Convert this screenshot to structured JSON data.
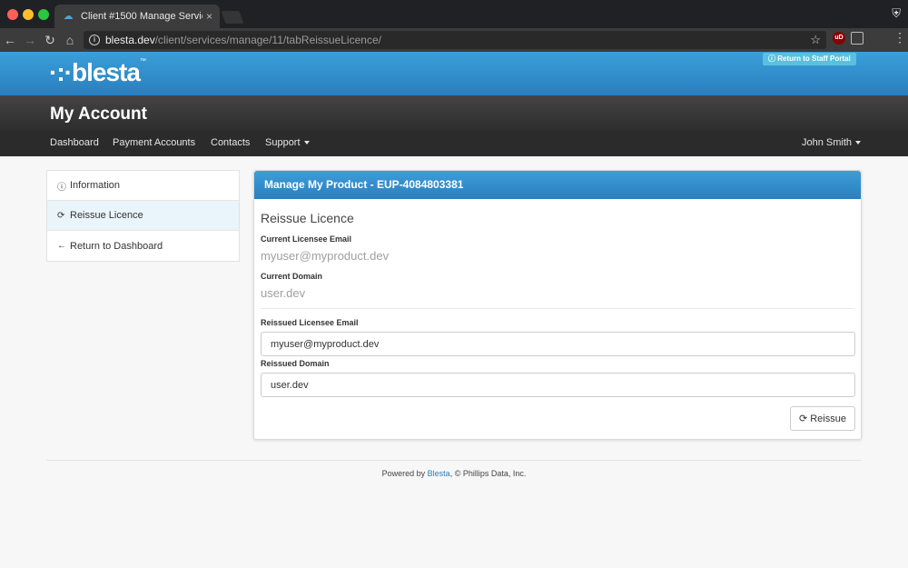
{
  "browser": {
    "tab_title": "Client #1500 Manage Service",
    "url_host": "blesta.dev",
    "url_path": "/client/services/manage/11/tabReissueLicence/",
    "extension_label": "uD"
  },
  "header": {
    "logo_text": "blesta",
    "logo_mark": "™",
    "staff_portal_label": "Return to Staff Portal",
    "page_title": "My Account"
  },
  "nav": {
    "items": [
      {
        "label": "Dashboard"
      },
      {
        "label": "Payment Accounts"
      },
      {
        "label": "Contacts"
      },
      {
        "label": "Support"
      }
    ],
    "user": "John Smith"
  },
  "sidebar": {
    "items": [
      {
        "label": "Information",
        "icon": "info-circle-icon"
      },
      {
        "label": "Reissue Licence",
        "icon": "refresh-icon"
      },
      {
        "label": "Return to Dashboard",
        "icon": "arrow-left-icon"
      }
    ]
  },
  "panel": {
    "heading": "Manage My Product - EUP-4084803381",
    "section_title": "Reissue Licence",
    "current_email_label": "Current Licensee Email",
    "current_email": "myuser@myproduct.dev",
    "current_domain_label": "Current Domain",
    "current_domain": "user.dev",
    "reissued_email_label": "Reissued Licensee Email",
    "reissued_email_value": "myuser@myproduct.dev",
    "reissued_domain_label": "Reissued Domain",
    "reissued_domain_value": "user.dev",
    "button_label": "Reissue"
  },
  "footer": {
    "prefix": "Powered by",
    "link": "Blesta",
    "suffix": ", © Phillips Data, Inc."
  }
}
